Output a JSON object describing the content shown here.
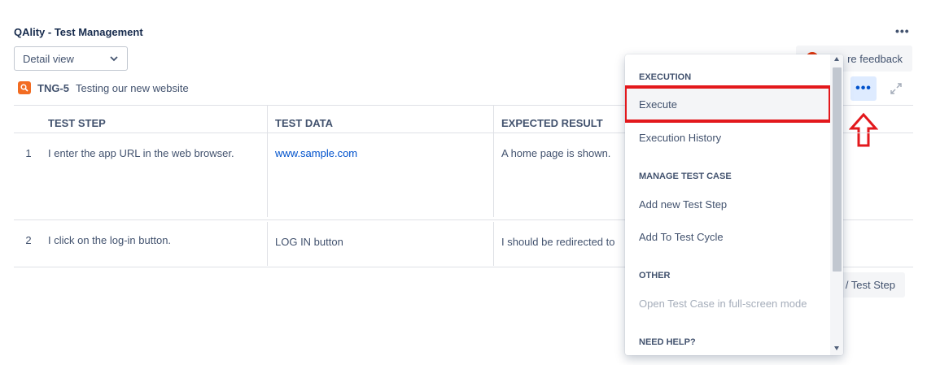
{
  "panel": {
    "title": "QAlity - Test Management",
    "more_label": "•••"
  },
  "view_select": {
    "value": "Detail view"
  },
  "feedback": {
    "label": "re feedback"
  },
  "issue": {
    "key": "TNG-5",
    "summary": "Testing our new website"
  },
  "actions": {
    "more_label": "•••"
  },
  "table": {
    "headers": [
      "TEST STEP",
      "TEST DATA",
      "EXPECTED RESULT"
    ],
    "rows": [
      {
        "num": "1",
        "step": "I enter the app URL in the web browser.",
        "data": "www.sample.com",
        "expected": "A home page is shown."
      },
      {
        "num": "2",
        "step": "I click on the log-in button.",
        "data": "LOG IN button",
        "expected": "I should be redirected to"
      }
    ]
  },
  "add_step": {
    "label": "/ Test Step"
  },
  "menu": {
    "sections": [
      {
        "heading": "EXECUTION",
        "items": [
          "Execute",
          "Execution History"
        ]
      },
      {
        "heading": "MANAGE TEST CASE",
        "items": [
          "Add new Test Step",
          "Add To Test Cycle"
        ]
      },
      {
        "heading": "OTHER",
        "items": [
          "Open Test Case in full-screen mode"
        ]
      },
      {
        "heading": "NEED HELP?",
        "items": []
      }
    ]
  },
  "colors": {
    "highlight": "#e3181c",
    "link": "#0052cc",
    "issue_icon": "#f26c22"
  }
}
